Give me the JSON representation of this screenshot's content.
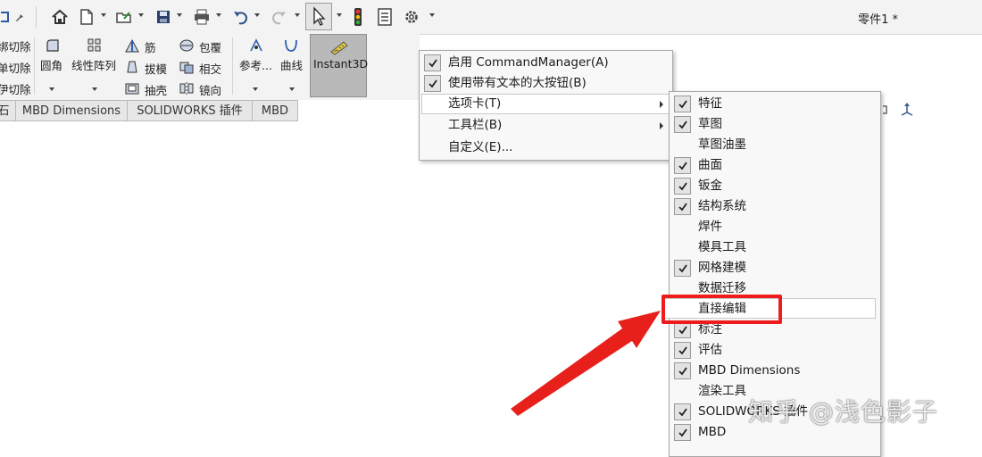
{
  "document": {
    "title": "零件1 *"
  },
  "toolbar": {
    "icons": [
      "home-icon",
      "new-file-icon",
      "open-icon",
      "save-icon",
      "print-icon",
      "undo-icon",
      "redo-icon",
      "select-icon",
      "rebuild-icon",
      "file-properties-icon",
      "options-icon"
    ]
  },
  "ribbon": {
    "left_labels": [
      "绑切除",
      "单切除",
      "伊切除"
    ],
    "fillet": "圆角",
    "linear_pattern": "线性阵列",
    "rib": "筋",
    "draft": "拔模",
    "shell": "抽壳",
    "wrap": "包覆",
    "intersect": "相交",
    "mirror": "镜向",
    "reference": "参考...",
    "curves": "曲线",
    "instant3d": "Instant3D"
  },
  "tabs": [
    {
      "label": "石"
    },
    {
      "label": "MBD Dimensions"
    },
    {
      "label": "SOLIDWORKS 插件"
    },
    {
      "label": "MBD"
    }
  ],
  "context_menu": {
    "items": [
      {
        "label": "启用 CommandManager(A)",
        "checked": true
      },
      {
        "label": "使用带有文本的大按钮(B)",
        "checked": true
      },
      {
        "label": "选项卡(T)",
        "submenu": true
      },
      {
        "label": "工具栏(B)",
        "submenu": true
      },
      {
        "label": "自定义(E)..."
      }
    ]
  },
  "tabs_submenu": {
    "items": [
      {
        "label": "特征",
        "checked": true
      },
      {
        "label": "草图",
        "checked": true
      },
      {
        "label": "草图油墨",
        "checked": false
      },
      {
        "label": "曲面",
        "checked": true
      },
      {
        "label": "钣金",
        "checked": true
      },
      {
        "label": "结构系统",
        "checked": true
      },
      {
        "label": "焊件",
        "checked": false
      },
      {
        "label": "模具工具",
        "checked": false
      },
      {
        "label": "网格建模",
        "checked": true
      },
      {
        "label": "数据迁移",
        "checked": false
      },
      {
        "label": "直接编辑",
        "checked": false
      },
      {
        "label": "标注",
        "checked": true
      },
      {
        "label": "评估",
        "checked": true
      },
      {
        "label": "MBD Dimensions",
        "checked": true
      },
      {
        "label": "渲染工具",
        "checked": false
      },
      {
        "label": "SOLIDWORKS 插件",
        "checked": true
      },
      {
        "label": "MBD",
        "checked": true
      }
    ]
  },
  "watermark": "知乎 @浅色影子",
  "colors": {
    "highlight": "#ee1c1c",
    "arrow": "#e8201c",
    "menu_bg": "#f8f8f8"
  }
}
